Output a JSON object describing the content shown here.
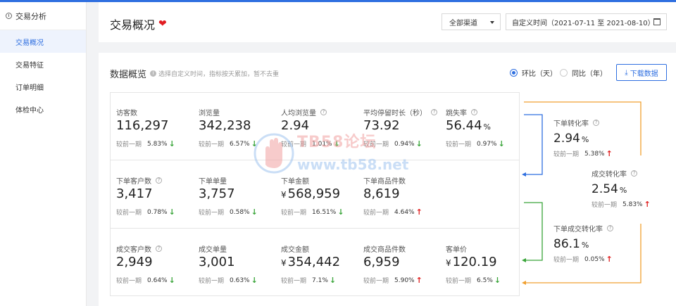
{
  "sidebar": {
    "section": "交易分析",
    "items": [
      {
        "label": "交易概况",
        "active": true
      },
      {
        "label": "交易特征",
        "active": false
      },
      {
        "label": "订单明细",
        "active": false
      },
      {
        "label": "体检中心",
        "active": false
      }
    ]
  },
  "header": {
    "title": "交易概况",
    "channel": "全部渠道",
    "date_range": "自定义时间（2021-07-11 至 2021-08-10）"
  },
  "overview": {
    "title": "数据概览",
    "hint": "选择自定义时间，指标按天累加，暂不去重",
    "radio_mom": "环比（天）",
    "radio_yoy": "同比（年）",
    "download": "下载数据",
    "compare_label": "较前一期"
  },
  "metrics": [
    [
      {
        "label": "访客数",
        "value": "116,297",
        "unit": "",
        "cur": "",
        "q": false,
        "pct": "5.83%",
        "dir": "down"
      },
      {
        "label": "浏览量",
        "value": "342,238",
        "unit": "",
        "cur": "",
        "q": false,
        "pct": "6.57%",
        "dir": "down"
      },
      {
        "label": "人均浏览量",
        "value": "2.94",
        "unit": "",
        "cur": "",
        "q": true,
        "pct": "1.01%",
        "dir": "down"
      },
      {
        "label": "平均停留时长（秒）",
        "value": "73.92",
        "unit": "",
        "cur": "",
        "q": true,
        "pct": "0.94%",
        "dir": "down"
      },
      {
        "label": "跳失率",
        "value": "56.44",
        "unit": "%",
        "cur": "",
        "q": true,
        "pct": "0.97%",
        "dir": "down"
      }
    ],
    [
      {
        "label": "下单客户数",
        "value": "3,417",
        "unit": "",
        "cur": "",
        "q": true,
        "pct": "0.78%",
        "dir": "down"
      },
      {
        "label": "下单单量",
        "value": "3,757",
        "unit": "",
        "cur": "",
        "q": false,
        "pct": "0.58%",
        "dir": "down"
      },
      {
        "label": "下单金额",
        "value": "568,959",
        "unit": "",
        "cur": "¥",
        "q": false,
        "pct": "16.51%",
        "dir": "down"
      },
      {
        "label": "下单商品件数",
        "value": "8,619",
        "unit": "",
        "cur": "",
        "q": false,
        "pct": "4.64%",
        "dir": "up"
      }
    ],
    [
      {
        "label": "成交客户数",
        "value": "2,949",
        "unit": "",
        "cur": "",
        "q": true,
        "pct": "0.64%",
        "dir": "down"
      },
      {
        "label": "成交单量",
        "value": "3,001",
        "unit": "",
        "cur": "",
        "q": false,
        "pct": "0.63%",
        "dir": "down"
      },
      {
        "label": "成交金额",
        "value": "354,442",
        "unit": "",
        "cur": "¥",
        "q": false,
        "pct": "7.1%",
        "dir": "down"
      },
      {
        "label": "成交商品件数",
        "value": "6,959",
        "unit": "",
        "cur": "",
        "q": false,
        "pct": "5.90%",
        "dir": "up"
      },
      {
        "label": "客单价",
        "value": "120.19",
        "unit": "",
        "cur": "¥",
        "q": false,
        "pct": "6.5%",
        "dir": "down"
      }
    ]
  ],
  "funnel": [
    {
      "label": "下单转化率",
      "value": "2.94",
      "unit": "%",
      "pct": "5.38%",
      "dir": "up"
    },
    {
      "label": "成交转化率",
      "value": "2.54",
      "unit": "%",
      "pct": "5.83%",
      "dir": "up"
    },
    {
      "label": "下单成交转化率",
      "value": "86.1",
      "unit": "%",
      "pct": "0.05%",
      "dir": "up"
    }
  ],
  "watermark": {
    "line1": "TB58论坛",
    "line2": "www.tb58.net"
  },
  "colors": {
    "accent": "#2f6fe0",
    "down": "#3aa53a",
    "up": "#e02020",
    "funnel_orange": "#f0a030",
    "funnel_blue": "#2f6fe0",
    "funnel_green": "#3aa53a"
  }
}
